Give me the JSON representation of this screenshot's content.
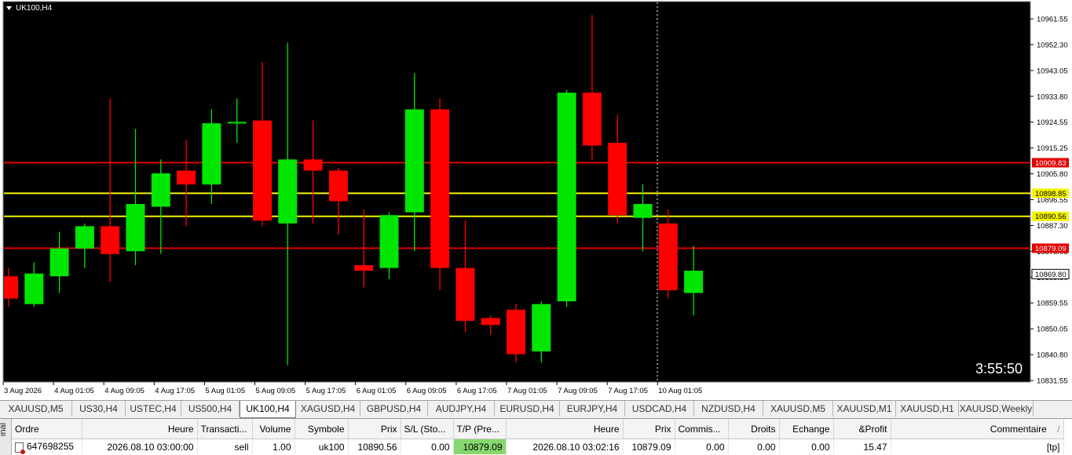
{
  "chart": {
    "title": "UK100,H4",
    "timer": "3:55:50",
    "colors": {
      "background": "#000000",
      "bull": "#00e600",
      "bear": "#ff0000",
      "sl_line": "#e00000",
      "tp_line": "#f5f500",
      "grid": "#ffffff"
    },
    "price_axis_ticks": [
      "10961.55",
      "10952.30",
      "10943.05",
      "10933.80",
      "10924.55",
      "10915.25",
      "10905.80",
      "10896.55",
      "10887.30",
      "10878.05",
      "10869.80",
      "10859.55",
      "10850.05",
      "10840.80",
      "10831.55"
    ],
    "time_axis_labels": [
      "3 Aug 2026",
      "4 Aug 01:05",
      "4 Aug 09:05",
      "4 Aug 17:05",
      "5 Aug 01:05",
      "5 Aug 09:05",
      "5 Aug 17:05",
      "6 Aug 01:05",
      "6 Aug 09:05",
      "6 Aug 17:05",
      "7 Aug 01:05",
      "7 Aug 09:05",
      "7 Aug 17:05",
      "10 Aug 01:05"
    ],
    "horizontal_lines": [
      {
        "label": "10909.83",
        "color": "#e00000",
        "kind": "order"
      },
      {
        "label": "10898.85",
        "color": "#f5f500",
        "kind": "level"
      },
      {
        "label": "10890.56",
        "color": "#f5f500",
        "kind": "level"
      },
      {
        "label": "10879.09",
        "color": "#e00000",
        "kind": "tp"
      }
    ],
    "current_price_label": "10869.80"
  },
  "chart_data": {
    "type": "candlestick",
    "title": "UK100,H4",
    "ylim": [
      10831.55,
      10961.55
    ],
    "candles": [
      {
        "o": 10869.0,
        "h": 10872.0,
        "l": 10858.0,
        "c": 10861.0
      },
      {
        "o": 10859.0,
        "h": 10874.0,
        "l": 10858.0,
        "c": 10870.0
      },
      {
        "o": 10869.0,
        "h": 10885.0,
        "l": 10863.0,
        "c": 10879.0
      },
      {
        "o": 10879.0,
        "h": 10888.0,
        "l": 10872.0,
        "c": 10887.0
      },
      {
        "o": 10887.0,
        "h": 10933.0,
        "l": 10867.0,
        "c": 10877.0
      },
      {
        "o": 10878.0,
        "h": 10922.0,
        "l": 10873.0,
        "c": 10895.0
      },
      {
        "o": 10894.0,
        "h": 10911.0,
        "l": 10877.0,
        "c": 10906.0
      },
      {
        "o": 10907.0,
        "h": 10918.0,
        "l": 10887.0,
        "c": 10902.0
      },
      {
        "o": 10902.0,
        "h": 10929.0,
        "l": 10895.0,
        "c": 10924.0
      },
      {
        "o": 10924.0,
        "h": 10933.0,
        "l": 10917.0,
        "c": 10924.5
      },
      {
        "o": 10925.0,
        "h": 10946.0,
        "l": 10887.0,
        "c": 10889.0
      },
      {
        "o": 10888.0,
        "h": 10953.0,
        "l": 10837.0,
        "c": 10911.0
      },
      {
        "o": 10911.0,
        "h": 10925.0,
        "l": 10888.0,
        "c": 10907.0
      },
      {
        "o": 10907.0,
        "h": 10908.0,
        "l": 10884.0,
        "c": 10896.0
      },
      {
        "o": 10873.0,
        "h": 10893.0,
        "l": 10865.0,
        "c": 10871.0
      },
      {
        "o": 10872.0,
        "h": 10892.0,
        "l": 10868.0,
        "c": 10891.0
      },
      {
        "o": 10892.0,
        "h": 10942.0,
        "l": 10878.0,
        "c": 10929.0
      },
      {
        "o": 10929.0,
        "h": 10933.0,
        "l": 10864.0,
        "c": 10872.0
      },
      {
        "o": 10872.0,
        "h": 10889.0,
        "l": 10849.0,
        "c": 10853.0
      },
      {
        "o": 10854.0,
        "h": 10855.0,
        "l": 10848.0,
        "c": 10851.5
      },
      {
        "o": 10857.0,
        "h": 10859.0,
        "l": 10838.0,
        "c": 10841.0
      },
      {
        "o": 10842.0,
        "h": 10860.0,
        "l": 10838.0,
        "c": 10859.0
      },
      {
        "o": 10860.0,
        "h": 10936.0,
        "l": 10858.0,
        "c": 10935.0
      },
      {
        "o": 10935.0,
        "h": 10963.0,
        "l": 10911.0,
        "c": 10916.0
      },
      {
        "o": 10917.0,
        "h": 10927.0,
        "l": 10888.0,
        "c": 10891.0
      },
      {
        "o": 10890.0,
        "h": 10902.0,
        "l": 10878.0,
        "c": 10895.0
      },
      {
        "o": 10888.0,
        "h": 10893.0,
        "l": 10861.0,
        "c": 10864.0
      },
      {
        "o": 10863.0,
        "h": 10880.0,
        "l": 10855.0,
        "c": 10871.0
      }
    ]
  },
  "tabs": [
    {
      "label": "XAUUSD,M5",
      "active": false
    },
    {
      "label": "US30,H4",
      "active": false
    },
    {
      "label": "USTEC,H4",
      "active": false
    },
    {
      "label": "US500,H4",
      "active": false
    },
    {
      "label": "UK100,H4",
      "active": true
    },
    {
      "label": "XAGUSD,H4",
      "active": false
    },
    {
      "label": "GBPUSD,H4",
      "active": false
    },
    {
      "label": "AUDJPY,H4",
      "active": false
    },
    {
      "label": "EURUSD,H4",
      "active": false
    },
    {
      "label": "EURJPY,H4",
      "active": false
    },
    {
      "label": "USDCAD,H4",
      "active": false
    },
    {
      "label": "NZDUSD,H4",
      "active": false
    },
    {
      "label": "XAUUSD,M5",
      "active": false
    },
    {
      "label": "XAUUSD,M1",
      "active": false
    },
    {
      "label": "XAUUSD,H1",
      "active": false
    },
    {
      "label": "XAUUSD,Weekly",
      "active": false
    }
  ],
  "terminal": {
    "side_label": "inal",
    "columns": [
      "Ordre",
      "Heure",
      "Transacti...",
      "Volume",
      "Symbole",
      "Prix",
      "S/L (Sto...",
      "T/P (Pre...",
      "Heure",
      "Prix",
      "Commis...",
      "Droits",
      "Echange",
      "&Profit",
      "Commentaire"
    ],
    "sort_indicator": "/",
    "rows": [
      {
        "ordre": "647698255",
        "heure": "2026.08.10 03:00:00",
        "transaction": "sell",
        "volume": "1.00",
        "symbole": "uk100",
        "prix": "10890.56",
        "sl": "0.00",
        "tp": "10879.09",
        "heure2": "2026.08.10 03:02:16",
        "prix2": "10879.09",
        "commission": "0.00",
        "droits": "0.00",
        "echange": "0.00",
        "profit": "15.47",
        "commentaire": "[tp]"
      }
    ]
  }
}
